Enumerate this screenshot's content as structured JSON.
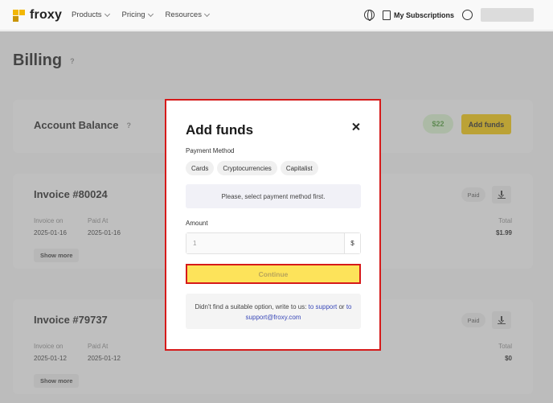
{
  "header": {
    "logo": "froxy",
    "nav": [
      {
        "label": "Products"
      },
      {
        "label": "Pricing"
      },
      {
        "label": "Resources"
      }
    ],
    "subscriptions": "My Subscriptions"
  },
  "page": {
    "title": "Billing",
    "help": "?"
  },
  "balance": {
    "title": "Account Balance",
    "help": "?",
    "amount": "$22",
    "add_funds": "Add funds"
  },
  "invoices": [
    {
      "title": "Invoice #80024",
      "status": "Paid",
      "invoice_on_label": "Invoice on",
      "invoice_on": "2025-01-16",
      "paid_at_label": "Paid At",
      "paid_at": "2025-01-16",
      "total_label": "Total",
      "total": "$1.99",
      "show_more": "Show more"
    },
    {
      "title": "Invoice #79737",
      "status": "Paid",
      "invoice_on_label": "Invoice on",
      "invoice_on": "2025-01-12",
      "paid_at_label": "Paid At",
      "paid_at": "2025-01-12",
      "total_label": "Total",
      "total": "$0",
      "show_more": "Show more"
    }
  ],
  "modal": {
    "title": "Add funds",
    "payment_method_label": "Payment Method",
    "methods": [
      "Cards",
      "Cryptocurrencies",
      "Capitalist"
    ],
    "notice": "Please, select payment method first.",
    "amount_label": "Amount",
    "amount_value": "1",
    "currency": "$",
    "continue": "Continue",
    "help_prefix": "Didn't find a suitable option, write to us:",
    "help_link1": "to support",
    "help_middle": "or",
    "help_link2": "to support@froxy.com"
  }
}
